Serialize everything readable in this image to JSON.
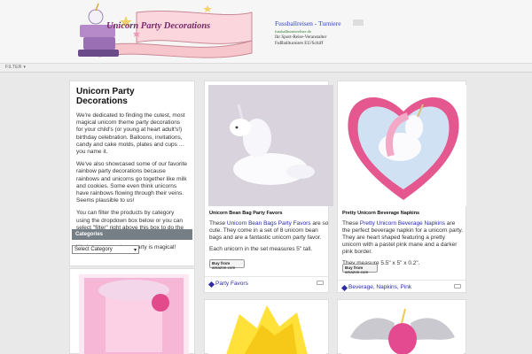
{
  "header": {
    "logo_text": "Unicorn Party Decorations",
    "ad": {
      "title": "Fussballreisen - Turniere",
      "url": "fussballturniereliste.de",
      "line1": "Ihr Sport-Reise-Veranstalter",
      "line2": "Fußballturniere EU/Schiff"
    }
  },
  "filter": {
    "label": "FILTER ▾"
  },
  "intro": {
    "title": "Unicorn Party Decorations",
    "p1": "We're dedicated to finding the cutest, most magical unicorn theme party decorations for your child's (or young at heart adult's!) birthday celebration. Balloons, invitations, candy and cake molds, plates and cups … you name it.",
    "p2": "We've also showcased some of our favorite rainbow party decorations because rainbows and unicorns go together like milk and cookies. Some even think unicorns have rainbows flowing through their veins. Seems plausible to us!",
    "p3": "You can filter the products by category using the dropdown box below or you can select \"filter\" right above this box to do the same.",
    "p4": "We hope your unicorn party is magical!",
    "categories_title": "Categories",
    "select_value": "Select Category"
  },
  "items": [
    {
      "title": "Unicorn Bean Bag Party Favors",
      "desc_pre": "These ",
      "desc_link": "Unicorn Bean Bags Party Favors",
      "desc_post": " are so cute. They come in a set of 8 unicorn bean bags and are a fantastic unicorn party favor.",
      "desc2": "Each unicorn in the set measures 5\" tall.",
      "buy": "amazon.com",
      "tags": "Party Favors"
    },
    {
      "title": "Pretty Unicorn Beverage Napkins",
      "desc_pre": "These ",
      "desc_link": "Pretty Unicorn Beverage Napkins",
      "desc_post": " are the perfect beverage napkin for a unicorn party. They are heart shaped featuring a pretty unicorn with a pastel pink mane and a darker pink border.",
      "desc2": "They measure 5.5\" x 5\" x 0.2\".",
      "buy": "amazon.com",
      "tags": "Beverage, Napkins, Pink"
    }
  ]
}
